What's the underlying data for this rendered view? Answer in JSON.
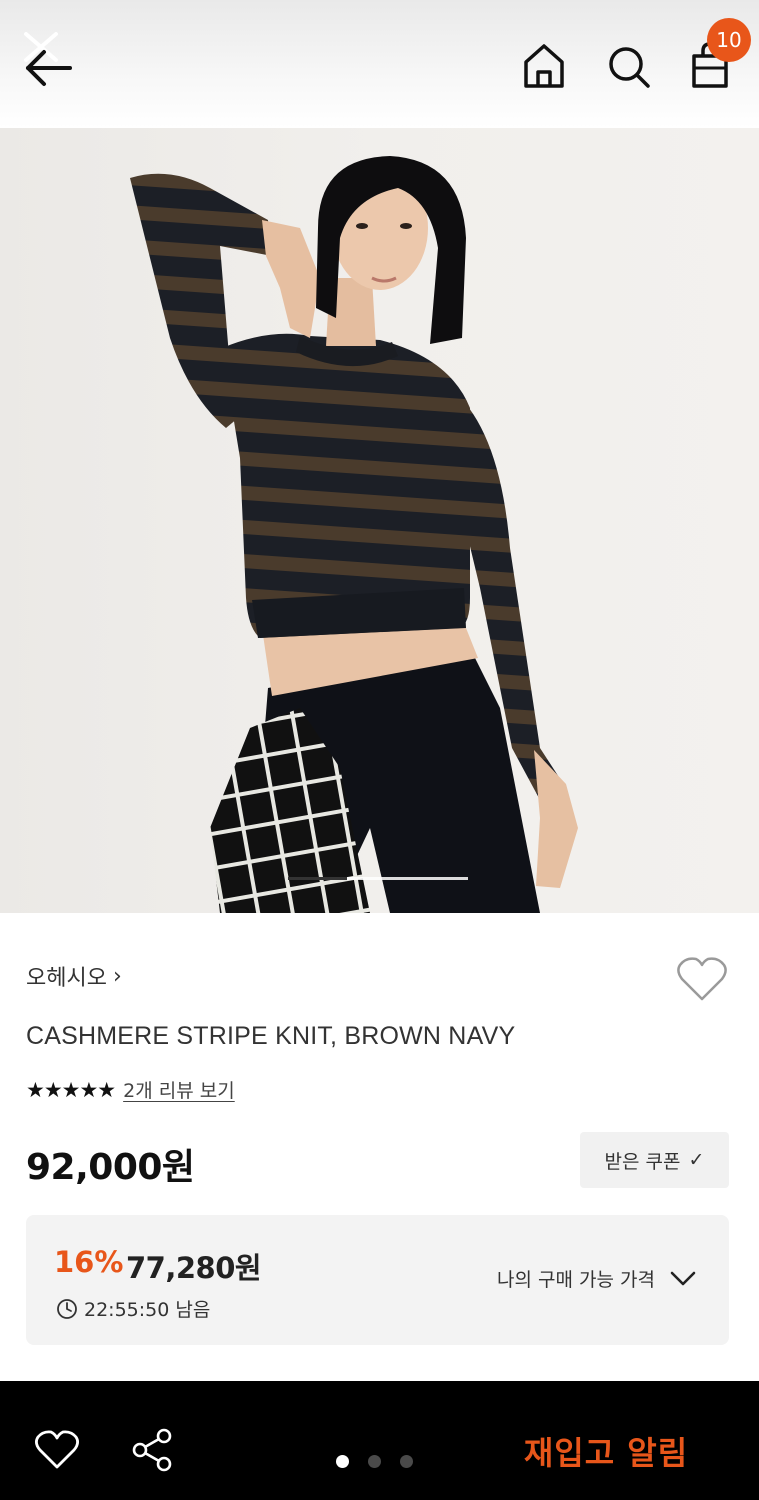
{
  "header": {
    "back_icon": "back-arrow-icon",
    "close_icon": "close-icon",
    "home_icon": "home-icon",
    "search_icon": "search-icon",
    "cart_icon": "shopping-bag-icon",
    "cart_count": "10"
  },
  "gallery": {
    "image_icon": "product-photo",
    "progress": 0.33
  },
  "product": {
    "brand": "오헤시오",
    "brand_chevron": "›",
    "title": "CASHMERE STRIPE KNIT, BROWN NAVY",
    "stars": "★★★★★",
    "review_link": "2개 리뷰 보기",
    "price": "92,000원",
    "coupon_label": "받은 쿠폰",
    "coupon_check": "✓"
  },
  "deal": {
    "discount": "16%",
    "price": "77,280원",
    "timer": "22:55:50 남음",
    "toggle_label": "나의 구매 가능 가격"
  },
  "bottom_bar": {
    "like_icon": "heart-outline-icon",
    "share_icon": "share-icon",
    "page_dots": 3,
    "active_dot": 0,
    "restock_label": "재입고 알림"
  },
  "colors": {
    "accent": "#e8561a",
    "bottom_bar_bg": "#000000",
    "deal_bg": "#f3f3f3"
  }
}
